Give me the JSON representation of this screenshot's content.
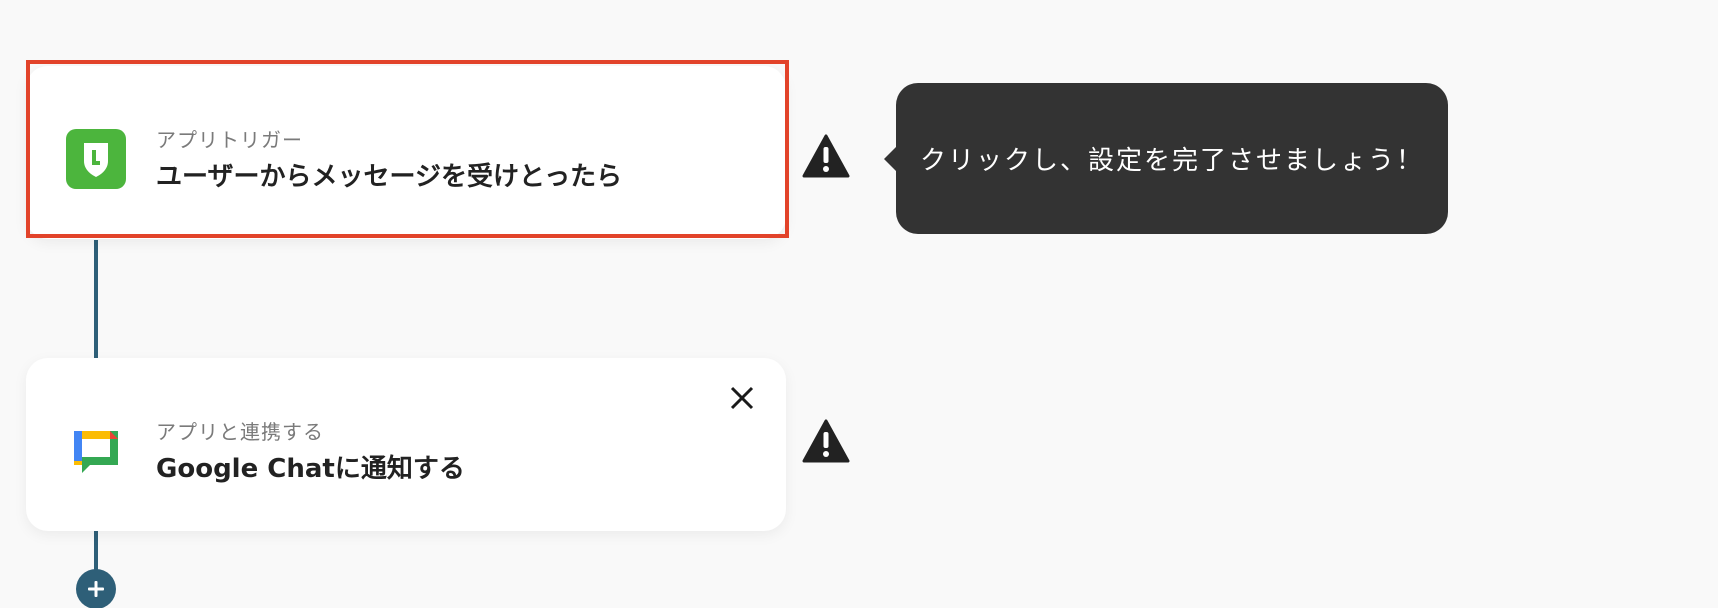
{
  "flow": {
    "steps": [
      {
        "label": "アプリトリガー",
        "title": "ユーザーからメッセージを受けとったら",
        "icon": "line-app-icon",
        "selected": true,
        "status_icon": "warning-icon"
      },
      {
        "label": "アプリと連携する",
        "title": "Google Chatに通知する",
        "icon": "google-chat-icon",
        "selected": false,
        "status_icon": "warning-icon",
        "close_icon": "close-icon"
      }
    ],
    "add_step_icon": "plus-icon"
  },
  "tooltip": {
    "text": "クリックし、設定を完了させましょう！"
  },
  "colors": {
    "background": "#f9f9f9",
    "connector": "#2e5f78",
    "highlight": "#e2432a",
    "tooltip_bg": "#333333",
    "line_green": "#4cb53d"
  }
}
